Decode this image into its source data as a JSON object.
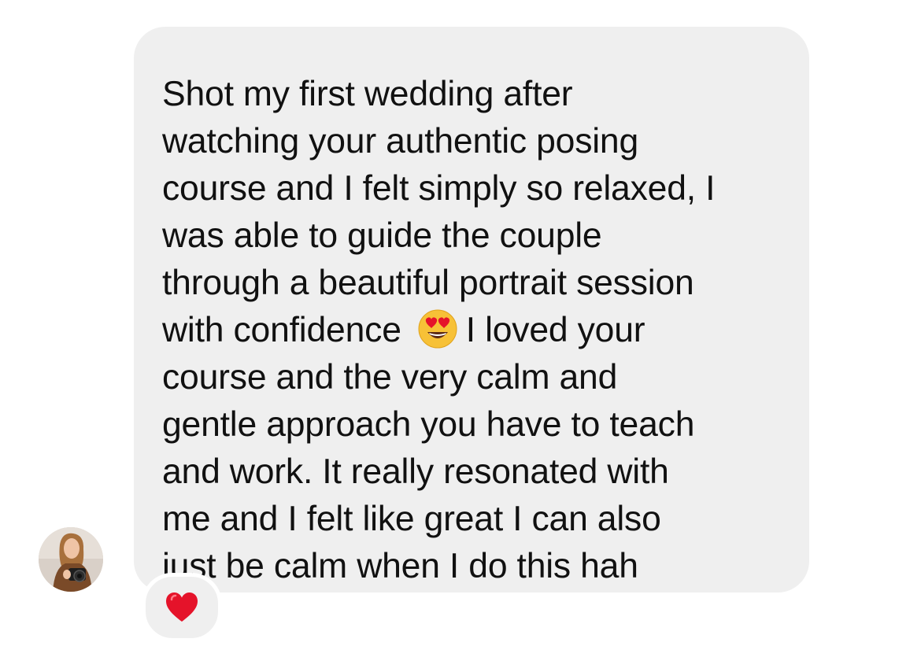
{
  "message": {
    "lines": [
      "Shot my first wedding after",
      "watching your authentic posing",
      "course and I felt simply so relaxed, I",
      "was able to guide the couple",
      "through a beautiful portrait session",
      "with confidence",
      "I loved your",
      "course and the very calm and",
      "gentle approach you have to teach",
      "and work. It really resonated with",
      "me and I felt like great I can also",
      "just be calm when I do this hah"
    ],
    "inline_emoji": "heart-eyes-emoji"
  },
  "reaction": {
    "icon": "red-heart-icon",
    "color": "#e5132a"
  },
  "avatar": {
    "icon": "avatar"
  },
  "colors": {
    "bubble": "#efefef",
    "text": "#111111",
    "background": "#ffffff"
  }
}
